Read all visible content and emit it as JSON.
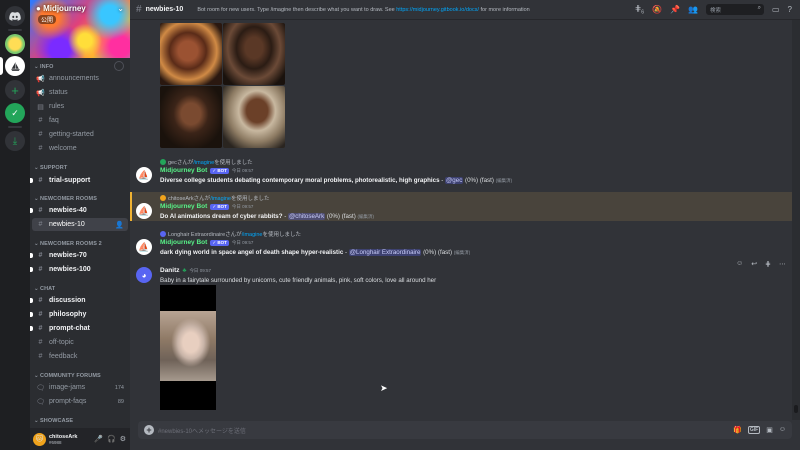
{
  "server": {
    "name": "Midjourney",
    "badge": "公開",
    "chevron": "chevron-down-icon"
  },
  "rail": {
    "items": [
      "discord-home-icon",
      "midjourney-server-avatar",
      "sailboat-server-icon",
      "add-server-icon",
      "explore-servers-icon",
      "download-apps-icon"
    ]
  },
  "sidebar": {
    "categories": {
      "info": "INFO",
      "support": "SUPPORT",
      "newcomer": "NEWCOMER ROOMS",
      "newcomer2": "NEWCOMER ROOMS 2",
      "chat": "CHAT",
      "community": "COMMUNITY FORUMS",
      "showcase": "SHOWCASE"
    },
    "channels": {
      "announcements": "announcements",
      "status": "status",
      "rules": "rules",
      "faq": "faq",
      "getting_started": "getting-started",
      "welcome": "welcome",
      "trial_support": "trial-support",
      "newbies40": "newbies-40",
      "newbies10": "newbies-10",
      "newbies70": "newbies-70",
      "newbies100": "newbies-100",
      "discussion": "discussion",
      "philosophy": "philosophy",
      "prompt_chat": "prompt-chat",
      "off_topic": "off-topic",
      "feedback": "feedback",
      "image_jams": "image-jams",
      "image_jams_count": "174",
      "prompt_faqs": "prompt-faqs",
      "prompt_faqs_count": "89"
    }
  },
  "user": {
    "name": "chitoseArk",
    "tag": "#6988"
  },
  "header": {
    "channel": "newbies-10",
    "topic_prefix": "Bot room for new users. Type /imagine then describe what you want to draw. See",
    "topic_link": "https://midjourney.gitbook.io/docs/",
    "topic_suffix": "for more information",
    "notif_count": "6",
    "search_placeholder": "検索"
  },
  "messages": [
    {
      "reply_user": "gecさんが",
      "reply_cmd": "/imagine",
      "reply_suffix": "を使用しました",
      "author": "Midjourney Bot",
      "badge": "✓ BOT",
      "time": "今日 09:57",
      "prompt": "Diverse college students debating contemporary moral problems, photorealistic, high graphics",
      "sep": " - ",
      "mention": "@gec",
      "status": "(0%) (fast)",
      "edited": "(編集済)"
    },
    {
      "reply_user": "chitoseArkさんが",
      "reply_cmd": "/imagine",
      "reply_suffix": "を使用しました",
      "author": "Midjourney Bot",
      "badge": "✓ BOT",
      "time": "今日 09:57",
      "prompt": "Do AI animations dream of cyber rabbits?",
      "sep": " - ",
      "mention": "@chitoseArk",
      "status": "(0%) (fast)",
      "edited": "(編集済)"
    },
    {
      "reply_user": "Longhair Extraordinaireさんが",
      "reply_cmd": "/imagine",
      "reply_suffix": "を使用しました",
      "author": "Midjourney Bot",
      "badge": "✓ BOT",
      "time": "今日 09:57",
      "prompt": "dark dying world in space angel of death shape hyper-realistic",
      "sep": " - ",
      "mention": "@Longhair Extraordinaire",
      "status": "(0%) (fast)",
      "edited": "(編集済)"
    },
    {
      "author": "Danitz",
      "time": "今日 09:57",
      "text": "Baby in a fairytale surrounded by unicorns, cute friendly animals, pink, soft colors, love all around her"
    }
  ],
  "composer": {
    "placeholder": "#newbies-10へメッセージを送信",
    "gif_label": "GIF"
  },
  "colors": {
    "accent": "#5865f2",
    "bot_name": "#57f287",
    "link": "#00a8fc",
    "highlight": "#49443c"
  }
}
